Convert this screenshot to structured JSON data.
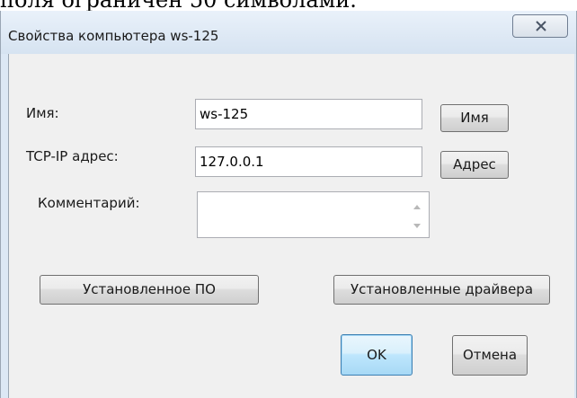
{
  "document": {
    "text_above": "поля ограничен 50 символами."
  },
  "window": {
    "title": "Свойства компьютера ws-125",
    "close_icon": "close-icon"
  },
  "form": {
    "name_label": "Имя:",
    "name_value": "ws-125",
    "name_button": "Имя",
    "ip_label": "TCP-IP адрес:",
    "ip_value": "127.0.0.1",
    "ip_button": "Адрес",
    "comment_label": "Комментарий:",
    "comment_value": ""
  },
  "buttons": {
    "installed_software": "Установленное ПО",
    "installed_drivers": "Установленные драйвера",
    "ok": "OK",
    "cancel": "Отмена"
  }
}
